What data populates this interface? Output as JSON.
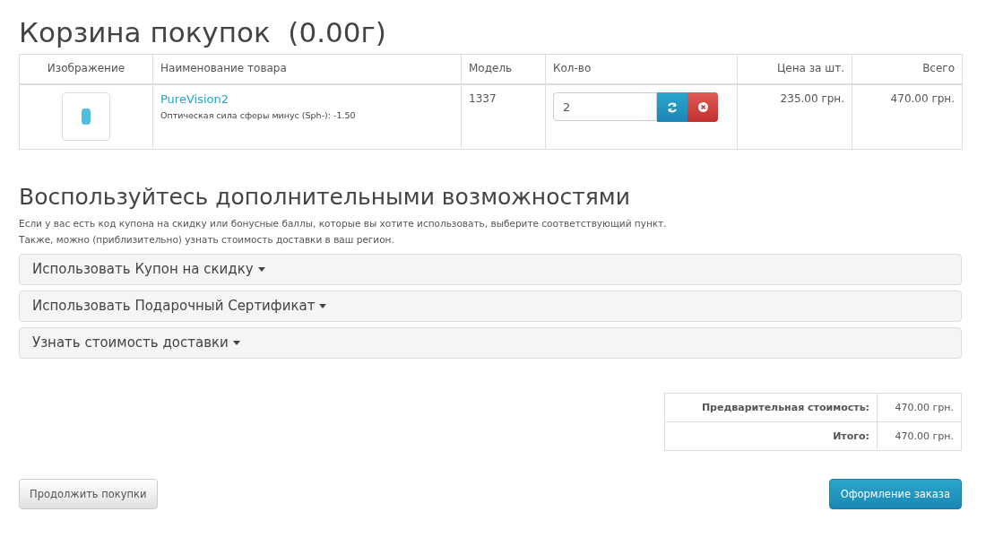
{
  "title": "Корзина покупок  (0.00г)",
  "cart_table": {
    "columns": [
      "Изображение",
      "Наименование товара",
      "Модель",
      "Кол-во",
      "Цена за шт.",
      "Всего"
    ],
    "rows": [
      {
        "name": "PureVision2",
        "option": "Оптическая сила сферы минус (Sph-): -1.50",
        "model": "1337",
        "quantity": "2",
        "unit_price": "235.00 грн.",
        "total": "470.00 грн."
      }
    ]
  },
  "extras": {
    "heading": "Воспользуйтесь дополнительными возможностями",
    "lines": [
      "Если у вас есть код купона на скидку или бонусные баллы, которые вы хотите использовать, выберите соответствующий пункт.",
      "Также, можно (приблизительно) узнать стоимость доставки в ваш регион."
    ],
    "panels": [
      "Использовать Купон на скидку",
      "Использовать Подарочный Сертификат",
      "Узнать стоимость доставки"
    ]
  },
  "totals": [
    {
      "label": "Предварительная стоимость:",
      "value": "470.00 грн."
    },
    {
      "label": "Итого:",
      "value": "470.00 грн."
    }
  ],
  "buttons": {
    "continue": "Продолжить покупки",
    "checkout": "Оформление заказа"
  }
}
